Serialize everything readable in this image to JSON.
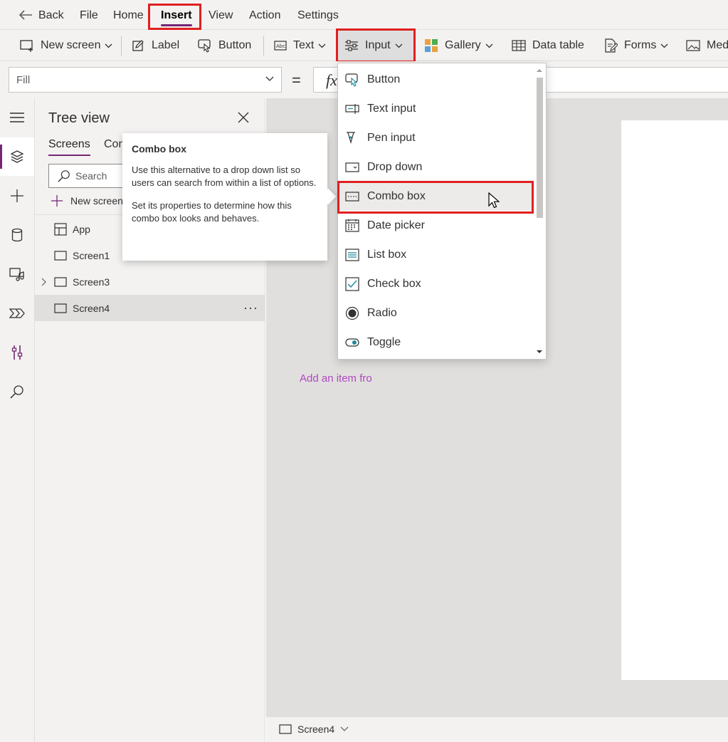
{
  "menu": {
    "back": "Back",
    "items": [
      "File",
      "Home",
      "Insert",
      "View",
      "Action",
      "Settings"
    ],
    "active": "Insert"
  },
  "commands": {
    "new_screen": "New screen",
    "label": "Label",
    "button": "Button",
    "text": "Text",
    "input": "Input",
    "gallery": "Gallery",
    "data_table": "Data table",
    "forms": "Forms",
    "media": "Med"
  },
  "formula": {
    "property": "Fill",
    "equals": "=",
    "fx": "fx"
  },
  "tree": {
    "title": "Tree view",
    "tabs": [
      "Screens",
      "Con"
    ],
    "search_placeholder": "Search",
    "new_screen": "New screen",
    "items": [
      {
        "label": "App",
        "icon": "app-icon"
      },
      {
        "label": "Screen1",
        "icon": "screen-icon"
      },
      {
        "label": "Screen3",
        "icon": "screen-icon",
        "expandable": true
      },
      {
        "label": "Screen4",
        "icon": "screen-icon",
        "selected": true
      }
    ],
    "more": "···"
  },
  "tooltip": {
    "title": "Combo box",
    "body1": "Use this alternative to a drop down list so users can search from within a list of options.",
    "body2": "Set its properties to determine how this combo box looks and behaves."
  },
  "input_menu": {
    "items": [
      {
        "label": "Button",
        "icon": "button-icon"
      },
      {
        "label": "Text input",
        "icon": "text-input-icon"
      },
      {
        "label": "Pen input",
        "icon": "pen-input-icon"
      },
      {
        "label": "Drop down",
        "icon": "drop-down-icon"
      },
      {
        "label": "Combo box",
        "icon": "combo-box-icon",
        "hovered": true
      },
      {
        "label": "Date picker",
        "icon": "date-picker-icon"
      },
      {
        "label": "List box",
        "icon": "list-box-icon"
      },
      {
        "label": "Check box",
        "icon": "check-box-icon"
      },
      {
        "label": "Radio",
        "icon": "radio-icon"
      },
      {
        "label": "Toggle",
        "icon": "toggle-icon"
      }
    ]
  },
  "canvas": {
    "hint": "Add an item fro"
  },
  "status": {
    "screen": "Screen4"
  },
  "colors": {
    "accent": "#742774",
    "highlight": "#e02020",
    "hint": "#b146c2"
  }
}
